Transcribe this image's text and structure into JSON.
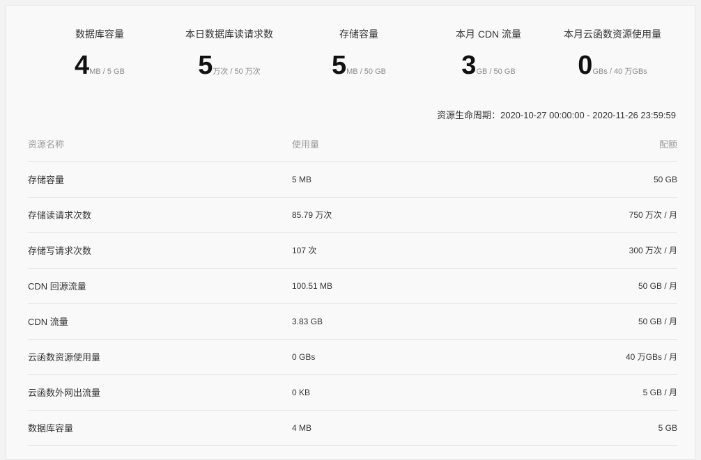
{
  "stats": [
    {
      "label": "数据库容量",
      "value": "4",
      "unit": "MB / 5 GB"
    },
    {
      "label": "本日数据库读请求数",
      "value": "5",
      "unit": "万次 / 50 万次"
    },
    {
      "label": "存储容量",
      "value": "5",
      "unit": "MB / 50 GB"
    },
    {
      "label": "本月 CDN 流量",
      "value": "3",
      "unit": "GB / 50 GB"
    },
    {
      "label": "本月云函数资源使用量",
      "value": "0",
      "unit": "GBs / 40 万GBs"
    }
  ],
  "period": "资源生命周期：2020-10-27 00:00:00 - 2020-11-26 23:59:59",
  "table": {
    "headers": {
      "name": "资源名称",
      "usage": "使用量",
      "quota": "配额"
    },
    "rows": [
      {
        "name": "存储容量",
        "usage": "5 MB",
        "quota": "50 GB"
      },
      {
        "name": "存储读请求次数",
        "usage": "85.79 万次",
        "quota": "750 万次 / 月"
      },
      {
        "name": "存储写请求次数",
        "usage": "107 次",
        "quota": "300 万次 / 月"
      },
      {
        "name": "CDN 回源流量",
        "usage": "100.51 MB",
        "quota": "50 GB / 月"
      },
      {
        "name": "CDN 流量",
        "usage": "3.83 GB",
        "quota": "50 GB / 月"
      },
      {
        "name": "云函数资源使用量",
        "usage": "0 GBs",
        "quota": "40 万GBs / 月"
      },
      {
        "name": "云函数外网出流量",
        "usage": "0 KB",
        "quota": "5 GB / 月"
      },
      {
        "name": "数据库容量",
        "usage": "4 MB",
        "quota": "5 GB"
      }
    ]
  }
}
